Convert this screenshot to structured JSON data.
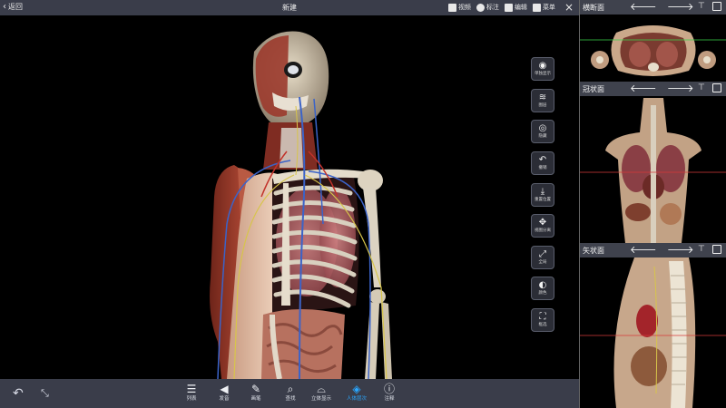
{
  "topbar": {
    "back_label": "返回",
    "title": "新建",
    "actions": [
      {
        "label": "视频",
        "icon": "video-icon"
      },
      {
        "label": "标注",
        "icon": "pin-icon"
      },
      {
        "label": "编辑",
        "icon": "edit-icon"
      },
      {
        "label": "菜单",
        "icon": "menu-icon"
      }
    ],
    "close_glyph": "☰"
  },
  "tools": [
    {
      "label": "单独显示",
      "icon": "isolate-eye-icon",
      "glyph": "◉"
    },
    {
      "label": "图层",
      "icon": "layers-icon",
      "glyph": "≋"
    },
    {
      "label": "隐藏",
      "icon": "eye-icon",
      "glyph": "◎"
    },
    {
      "label": "撤销",
      "icon": "undo-icon",
      "glyph": "↶"
    },
    {
      "label": "重置位置",
      "icon": "reset-position-icon",
      "glyph": "⤓"
    },
    {
      "label": "视图分离",
      "icon": "explode-icon",
      "glyph": "✥"
    },
    {
      "label": "全局",
      "icon": "fullscreen-icon",
      "glyph": "⤢"
    },
    {
      "label": "颜色",
      "icon": "palette-icon",
      "glyph": "◐"
    },
    {
      "label": "框选",
      "icon": "frame-select-icon",
      "glyph": "⛶"
    }
  ],
  "bottom": {
    "undo_glyph": "↶",
    "collapse_glyph": "⤡",
    "items": [
      {
        "label": "列表",
        "icon": "list-icon",
        "glyph": "☰",
        "active": false
      },
      {
        "label": "发音",
        "icon": "speaker-icon",
        "glyph": "◀",
        "active": false
      },
      {
        "label": "画笔",
        "icon": "pen-icon",
        "glyph": "✎",
        "active": false
      },
      {
        "label": "查找",
        "icon": "search-icon",
        "glyph": "⌕",
        "active": false
      },
      {
        "label": "立体显示",
        "icon": "stereo-glasses-icon",
        "glyph": "⌓",
        "active": false
      },
      {
        "label": "人体层次",
        "icon": "body-layers-icon",
        "glyph": "◈",
        "active": true
      },
      {
        "label": "注释",
        "icon": "info-icon",
        "glyph": "ⓘ",
        "active": false
      }
    ]
  },
  "panel": {
    "sections": [
      {
        "title": "横断面",
        "icon": "transverse-view"
      },
      {
        "title": "冠状面",
        "icon": "coronal-view"
      },
      {
        "title": "矢状面",
        "icon": "sagittal-view"
      }
    ],
    "left_arrow": "🡐",
    "right_arrow": "🡒",
    "pin_glyph": "⊤"
  },
  "colors": {
    "bar": "#3a3d4a",
    "accent": "#2aa7ff",
    "tissue": "#d9b9a0",
    "muscle": "#a5402f",
    "vein": "#3b63c8",
    "nerve": "#d7c54a"
  }
}
